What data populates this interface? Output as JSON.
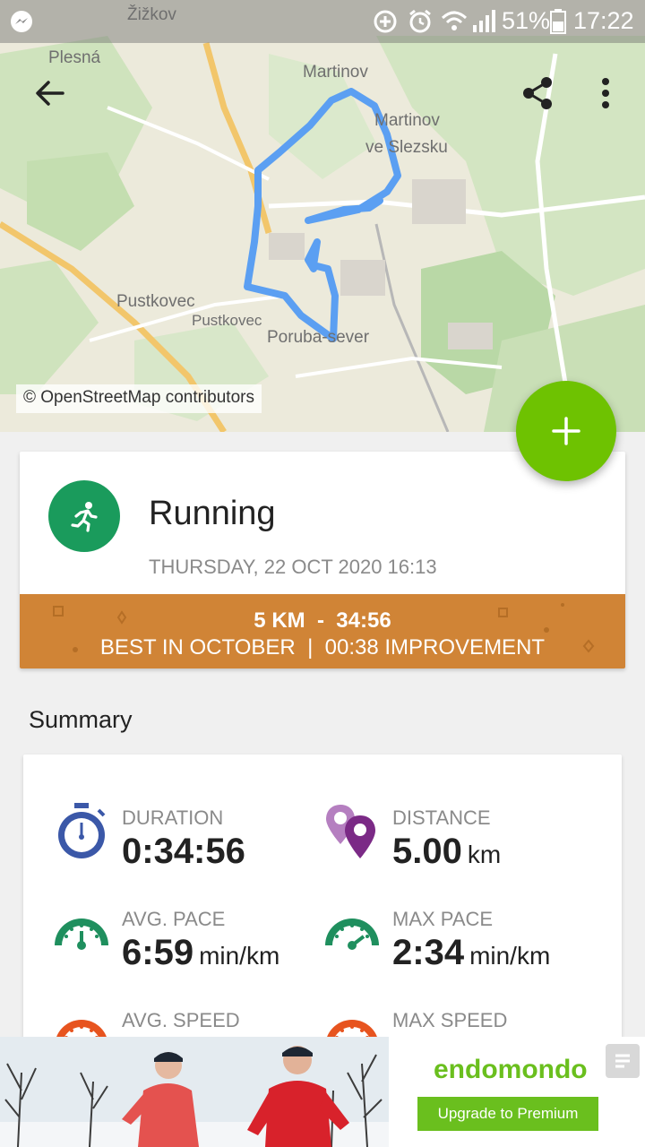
{
  "status_bar": {
    "battery": "51%",
    "time": "17:22"
  },
  "map": {
    "labels": [
      "Žižkov",
      "Plesná",
      "Martinov",
      "Martinov",
      "ve Slezsku",
      "Pustkovec",
      "Pustkovec",
      "Poruba-sever"
    ],
    "attribution": "© OpenStreetMap contributors"
  },
  "activity": {
    "sport": "Running",
    "date": "THURSDAY, 22 OCT 2020 16:13",
    "banner_line1": "5 KM  -  34:56",
    "banner_line2": "BEST IN OCTOBER  |  00:38 IMPROVEMENT"
  },
  "summary": {
    "title": "Summary",
    "stats": [
      {
        "label": "DURATION",
        "value": "0:34:56",
        "unit": "",
        "icon": "stopwatch-icon"
      },
      {
        "label": "DISTANCE",
        "value": "5.00",
        "unit": "km",
        "icon": "location-pins-icon"
      },
      {
        "label": "AVG. PACE",
        "value": "6:59",
        "unit": "min/km",
        "icon": "pace-gauge-icon"
      },
      {
        "label": "MAX PACE",
        "value": "2:34",
        "unit": "min/km",
        "icon": "pace-gauge-icon"
      },
      {
        "label": "AVG. SPEED",
        "value": "",
        "unit": "",
        "icon": "speed-gauge-icon"
      },
      {
        "label": "MAX SPEED",
        "value": "",
        "unit": "",
        "icon": "speed-gauge-icon"
      }
    ]
  },
  "ad": {
    "brand": "endomondo",
    "cta": "Upgrade to Premium"
  },
  "colors": {
    "accent_green": "#6ec201",
    "sport_green": "#1a9b5c",
    "banner_orange": "#d08436",
    "route_blue": "#5b9ff2"
  }
}
